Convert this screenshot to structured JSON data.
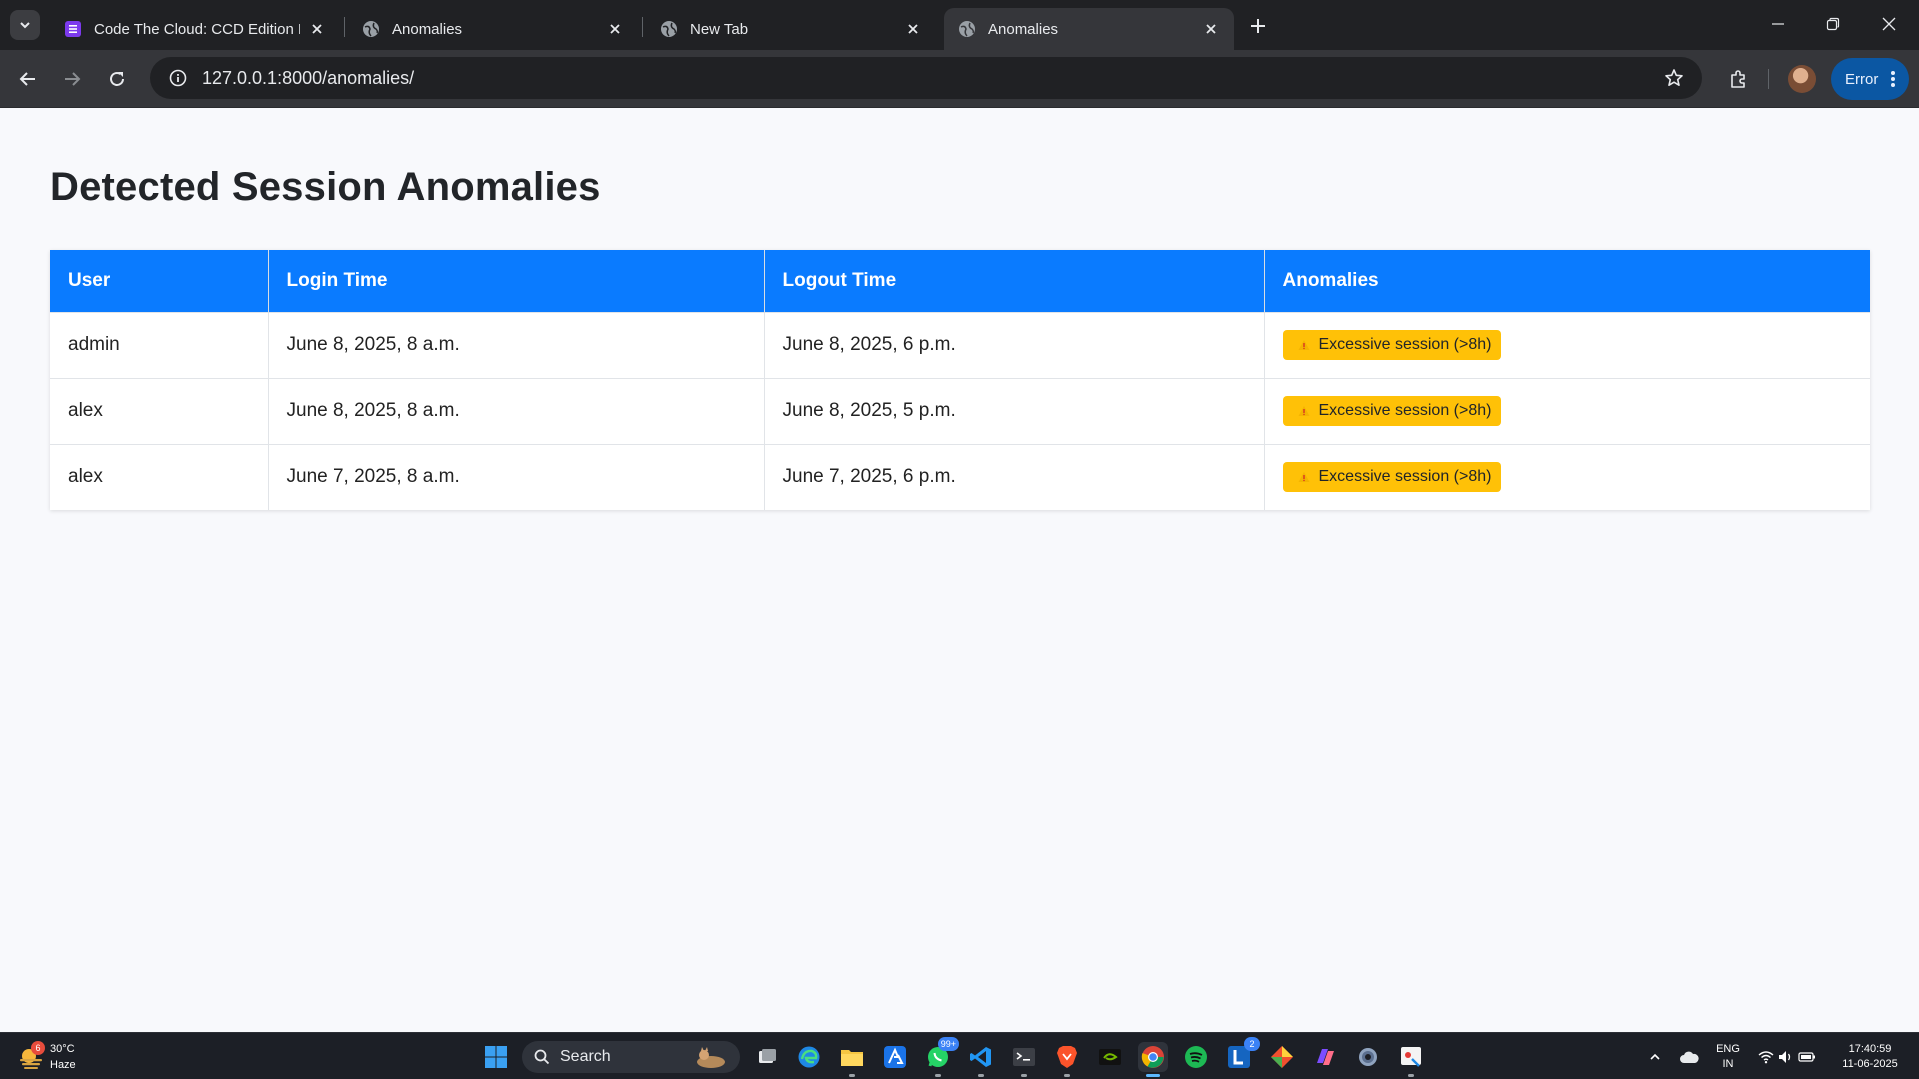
{
  "browser": {
    "tabs": [
      {
        "title": "Code The Cloud: CCD Edition H"
      },
      {
        "title": "Anomalies"
      },
      {
        "title": "New Tab"
      },
      {
        "title": "Anomalies"
      }
    ],
    "url": "127.0.0.1:8000/anomalies/",
    "error_label": "Error"
  },
  "page": {
    "title": "Detected Session Anomalies",
    "columns": [
      "User",
      "Login Time",
      "Logout Time",
      "Anomalies"
    ],
    "rows": [
      {
        "user": "admin",
        "login": "June 8, 2025, 8 a.m.",
        "logout": "June 8, 2025, 6 p.m.",
        "anomaly": "Excessive session (>8h)"
      },
      {
        "user": "alex",
        "login": "June 8, 2025, 8 a.m.",
        "logout": "June 8, 2025, 5 p.m.",
        "anomaly": "Excessive session (>8h)"
      },
      {
        "user": "alex",
        "login": "June 7, 2025, 8 a.m.",
        "logout": "June 7, 2025, 6 p.m.",
        "anomaly": "Excessive session (>8h)"
      }
    ],
    "colors": {
      "header": "#0a7bff",
      "badge": "#ffc107"
    }
  },
  "taskbar": {
    "weather": {
      "temp": "30°C",
      "desc": "Haze",
      "badge": "6"
    },
    "search_label": "Search",
    "whatsapp_badge": "99+",
    "teams_badge": "2",
    "lang_top": "ENG",
    "lang_bottom": "IN",
    "time": "17:40:59",
    "date": "11-06-2025"
  }
}
